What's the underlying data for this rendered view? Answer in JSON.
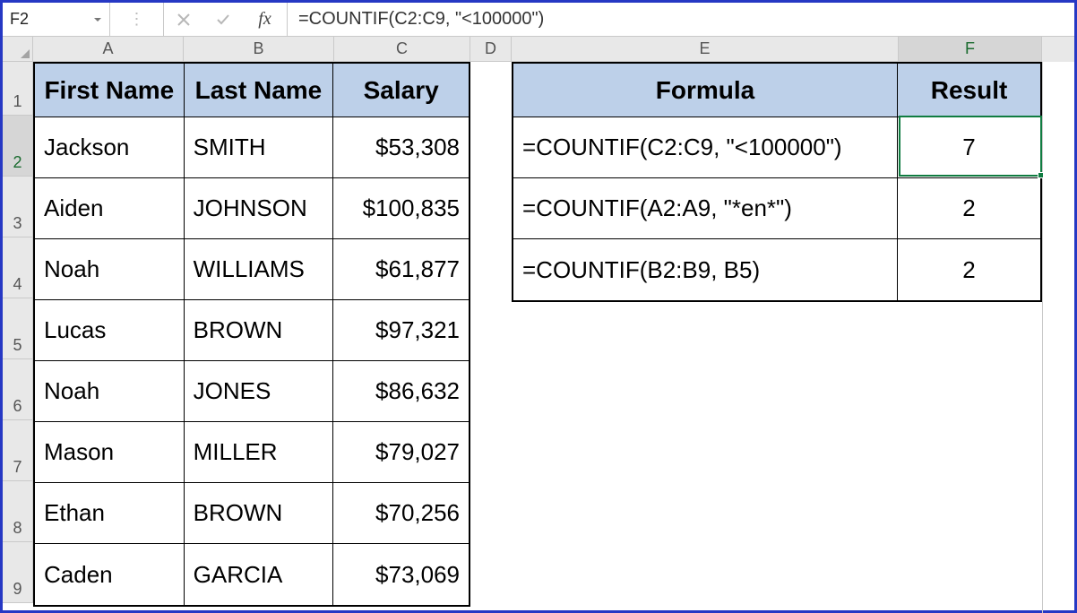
{
  "name_box": "F2",
  "formula_bar": "=COUNTIF(C2:C9, \"<100000\")",
  "fx_label": "fx",
  "ellipsis": "⋮",
  "columns": {
    "A": "A",
    "B": "B",
    "C": "C",
    "D": "D",
    "E": "E",
    "F": "F"
  },
  "row_labels": [
    "1",
    "2",
    "3",
    "4",
    "5",
    "6",
    "7",
    "8",
    "9"
  ],
  "headers_main": {
    "first": "First Name",
    "last": "Last Name",
    "salary": "Salary"
  },
  "data": [
    {
      "first": "Jackson",
      "last": "SMITH",
      "salary": "$53,308"
    },
    {
      "first": "Aiden",
      "last": "JOHNSON",
      "salary": "$100,835"
    },
    {
      "first": "Noah",
      "last": "WILLIAMS",
      "salary": "$61,877"
    },
    {
      "first": "Lucas",
      "last": "BROWN",
      "salary": "$97,321"
    },
    {
      "first": "Noah",
      "last": "JONES",
      "salary": "$86,632"
    },
    {
      "first": "Mason",
      "last": "MILLER",
      "salary": "$79,027"
    },
    {
      "first": "Ethan",
      "last": "BROWN",
      "salary": "$70,256"
    },
    {
      "first": "Caden",
      "last": "GARCIA",
      "salary": "$73,069"
    }
  ],
  "headers_formula": {
    "formula": "Formula",
    "result": "Result"
  },
  "formulas": [
    {
      "formula": "=COUNTIF(C2:C9, \"<100000\")",
      "result": "7"
    },
    {
      "formula": "=COUNTIF(A2:A9, \"*en*\")",
      "result": "2"
    },
    {
      "formula": "=COUNTIF(B2:B9, B5)",
      "result": "2"
    }
  ],
  "active_cell": "F2",
  "colors": {
    "border": "#2638c4",
    "header_bg": "#bdd0e9",
    "select_green": "#107c41"
  }
}
